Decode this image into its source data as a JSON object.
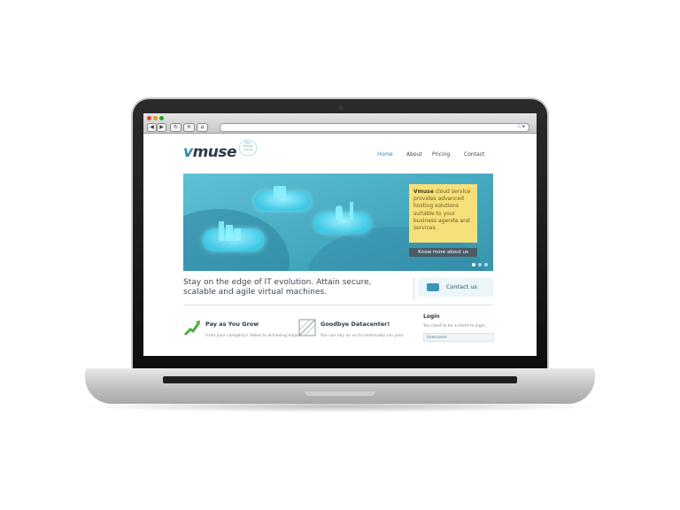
{
  "browser": {
    "url": ""
  },
  "site": {
    "logo": {
      "prefix": "v",
      "rest": "muse",
      "tagline_mark": "Your Smart Cloud"
    },
    "nav": [
      "Home",
      "About",
      "Pricing",
      "Contact"
    ],
    "hero": {
      "callout_brand": "Vmuse",
      "callout_text": " cloud service provides advanced hosting solutions suitable to your business agenda and services.",
      "button": "Know more about us",
      "slide_count": 3,
      "active_slide": 1
    },
    "tagline": "Stay on the edge of IT evolution. Attain secure, scalable and agile virtual machines.",
    "contact_label": "Contact us",
    "features": [
      {
        "title": "Pay as You Grow",
        "text": "From your company's debut to achieving major",
        "icon": "growth-arrow-icon"
      },
      {
        "title": "Goodbye Datacenter!",
        "text": "You can rely on us to continually run your",
        "icon": "datacenter-grid-icon"
      }
    ],
    "login": {
      "title": "Login",
      "text": "You need to be a client to login.",
      "username_placeholder": "Username"
    },
    "colors": {
      "accent": "#2b8cb0",
      "hero": "#45a9c0",
      "callout": "#f7e07a",
      "button": "#4a5c66"
    }
  }
}
